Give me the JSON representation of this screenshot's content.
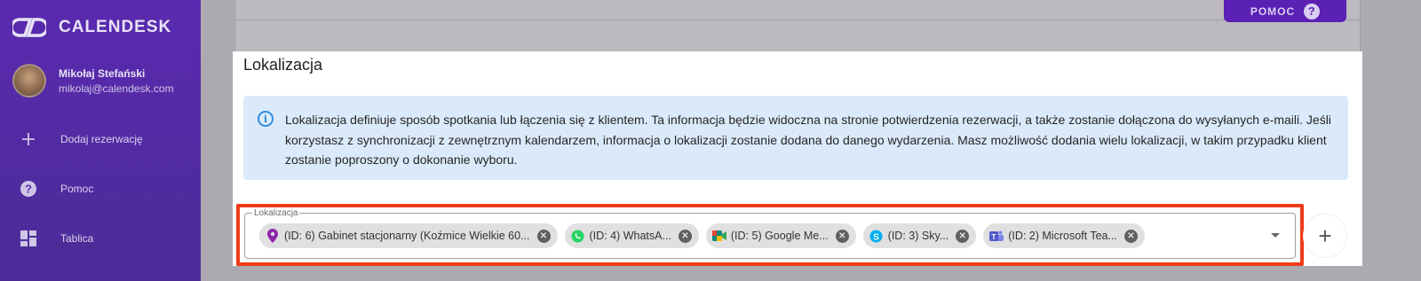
{
  "brand": {
    "name": "CALENDESK"
  },
  "user": {
    "name": "Mikołaj Stefański",
    "email": "mikolaj@calendesk.com"
  },
  "sidebar": {
    "items": [
      {
        "label": "Dodaj rezerwację",
        "icon": "plus-icon"
      },
      {
        "label": "Pomoc",
        "icon": "help-circle-icon"
      },
      {
        "label": "Tablica",
        "icon": "dashboard-icon"
      }
    ]
  },
  "header": {
    "help_label": "POMOC",
    "help_icon": "?"
  },
  "modal": {
    "title": "Lokalizacja",
    "info": "Lokalizacja definiuje sposób spotkania lub łączenia się z klientem. Ta informacja będzie widoczna na stronie potwierdzenia rezerwacji, a także zostanie dołączona do wysyłanych e-maili. Jeśli korzystasz z synchronizacji z zewnętrznym kalendarzem, informacja o lokalizacji zostanie dodana do danego wydarzenia. Masz możliwość dodania wielu lokalizacji, w takim przypadku klient zostanie poproszony o dokonanie wyboru.",
    "field_label": "Lokalizacja",
    "chips": [
      {
        "label": "(ID: 6) Gabinet stacjonarny (Koźmice Wielkie 60...",
        "icon": "location-pin-icon",
        "color": "#8e24aa"
      },
      {
        "label": "(ID: 4) WhatsA...",
        "icon": "whatsapp-icon",
        "color": "#25d366"
      },
      {
        "label": "(ID: 5) Google Me...",
        "icon": "google-meet-icon",
        "color": "#00897b"
      },
      {
        "label": "(ID: 3) Sky...",
        "icon": "skype-icon",
        "color": "#00aff0"
      },
      {
        "label": "(ID: 2) Microsoft Tea...",
        "icon": "microsoft-teams-icon",
        "color": "#5059c9"
      }
    ],
    "add_label": "+"
  }
}
